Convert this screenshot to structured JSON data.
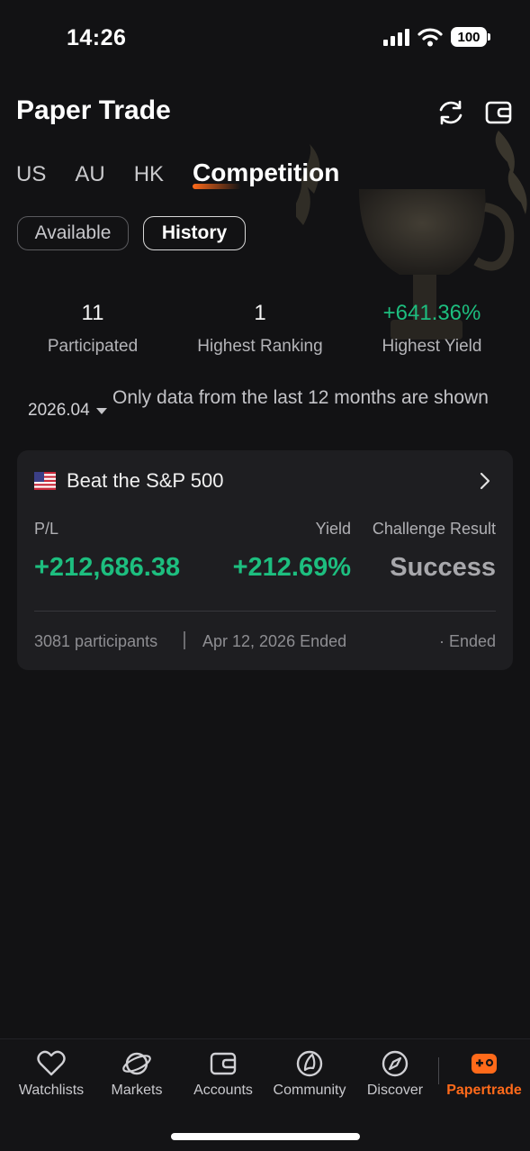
{
  "status_bar": {
    "time": "14:26",
    "battery": "100"
  },
  "header": {
    "title": "Paper Trade"
  },
  "market_tabs": [
    {
      "label": "US",
      "active": false
    },
    {
      "label": "AU",
      "active": false
    },
    {
      "label": "HK",
      "active": false
    },
    {
      "label": "Competition",
      "active": true
    }
  ],
  "filters": {
    "available": "Available",
    "history": "History",
    "selected": "History"
  },
  "stats": {
    "participated": {
      "value": "11",
      "label": "Participated"
    },
    "highest_ranking": {
      "value": "1",
      "label": "Highest Ranking"
    },
    "highest_yield": {
      "value": "+641.36%",
      "label": "Highest Yield"
    }
  },
  "period": {
    "selected": "2026.04",
    "note": "Only data from the last 12 months are shown"
  },
  "competitions": [
    {
      "title": "Beat the S&P 500",
      "pl_label": "P/L",
      "yield_label": "Yield",
      "result_label": "Challenge Result",
      "pl_value": "+212,686.38",
      "yield_value": "+212.69%",
      "result_value": "Success",
      "participants": "3081 participants",
      "ended_date": "Apr 12, 2026 Ended",
      "status": "· Ended"
    }
  ],
  "bottom_nav": [
    {
      "label": "Watchlists",
      "icon": "heart-icon",
      "active": false
    },
    {
      "label": "Markets",
      "icon": "planet-icon",
      "active": false
    },
    {
      "label": "Accounts",
      "icon": "wallet-icon",
      "active": false
    },
    {
      "label": "Community",
      "icon": "community-icon",
      "active": false
    },
    {
      "label": "Discover",
      "icon": "compass-icon",
      "active": false
    },
    {
      "label": "Papertrade",
      "icon": "gamepad-icon",
      "active": true
    }
  ],
  "colors": {
    "accent": "#ff6a1a",
    "positive": "#1dbe7f",
    "background": "#121214",
    "card": "#1e1e21"
  }
}
